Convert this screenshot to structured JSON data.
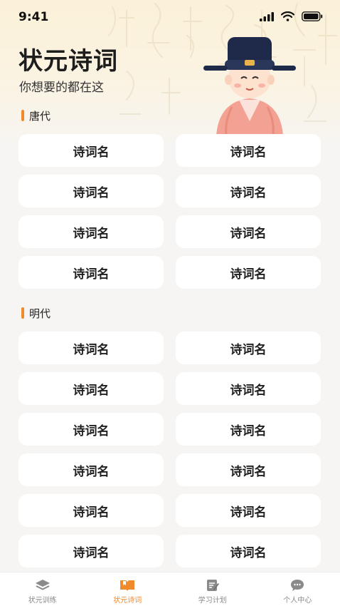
{
  "status_bar": {
    "time": "9:41",
    "signal_icon": "cellular-signal-icon",
    "wifi_icon": "wifi-icon",
    "battery_icon": "battery-icon"
  },
  "header": {
    "title": "状元诗词",
    "subtitle": "你想要的都在这",
    "mascot": "scholar-mascot-illustration"
  },
  "sections": [
    {
      "label": "唐代",
      "items": [
        "诗词名",
        "诗词名",
        "诗词名",
        "诗词名",
        "诗词名",
        "诗词名",
        "诗词名",
        "诗词名"
      ]
    },
    {
      "label": "明代",
      "items": [
        "诗词名",
        "诗词名",
        "诗词名",
        "诗词名",
        "诗词名",
        "诗词名",
        "诗词名",
        "诗词名",
        "诗词名",
        "诗词名",
        "诗词名",
        "诗词名"
      ]
    }
  ],
  "tabbar": {
    "tabs": [
      {
        "label": "状元训练",
        "icon": "layers-icon",
        "active": false
      },
      {
        "label": "状元诗词",
        "icon": "book-icon",
        "active": true
      },
      {
        "label": "学习计划",
        "icon": "notepad-pen-icon",
        "active": false
      },
      {
        "label": "个人中心",
        "icon": "chat-bubble-icon",
        "active": false
      }
    ]
  },
  "colors": {
    "accent": "#f08a2a",
    "inactive_tab": "#8a8a8a",
    "card_bg": "#ffffff",
    "page_bg": "#f6f5f3"
  }
}
